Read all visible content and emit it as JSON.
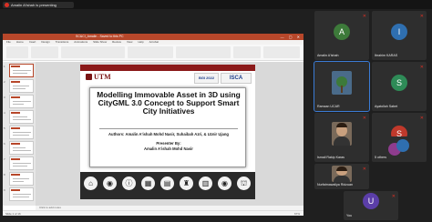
{
  "meeting": {
    "presenting_label": "Amalin A'ishah is presenting"
  },
  "powerpoint": {
    "title": "SC&CI_Amalin - Saved to this PC",
    "window_controls": "— ▢ ✕",
    "tabs": [
      "File",
      "Home",
      "Insert",
      "Design",
      "Transitions",
      "Animations",
      "Slide Show",
      "Review",
      "View",
      "Help",
      "Acrobat"
    ],
    "thumb_numbers": [
      "1",
      "2",
      "3",
      "4",
      "5",
      "6",
      "7",
      "8",
      "9"
    ],
    "notes_placeholder": "Click to add notes",
    "status_text": "Slide 1 of 16",
    "zoom_text": "67%"
  },
  "slide": {
    "logo_text": "UTM",
    "partner1": "BGI 2022",
    "partner2": "ISCA",
    "title": "Modelling Immovable Asset in 3D using CityGML 3.0 Concept to Support Smart City Initiatives",
    "authors": "Authors: Amalin A'ishah Mohd Nasir, Suhaibah Azri, & Uznir Ujang",
    "presenter_label": "Presenter By:",
    "presenter_name": "Amalin A'ishah Mohd Nasir",
    "icons": [
      "home-icon",
      "car-icon",
      "info-icon",
      "building-icon",
      "factory-icon",
      "lighthouse-icon",
      "shop-icon",
      "car-icon",
      "bank-icon"
    ],
    "icon_glyphs": [
      "⌂",
      "◉",
      "ⓘ",
      "▦",
      "▤",
      "♜",
      "▥",
      "◉",
      "⛫"
    ]
  },
  "participants": [
    {
      "name": "Amalin A'ishah",
      "initial": "A",
      "color": "#3d7a3a",
      "type": "avatar",
      "muted": true
    },
    {
      "name": "Ibrahim KARAS",
      "initial": "I",
      "color": "#2f6fb0",
      "type": "avatar",
      "muted": true
    },
    {
      "name": "Ramzan UCAR",
      "initial": "",
      "color": "",
      "type": "tree",
      "muted": false
    },
    {
      "name": "Ayatollah Sabet",
      "initial": "S",
      "color": "#2e8b57",
      "type": "avatar",
      "muted": true
    },
    {
      "name": "Ismail Rakip Karas",
      "initial": "",
      "color": "",
      "type": "photo",
      "muted": true
    },
    {
      "name": "Suhaibah Azri",
      "initial": "S",
      "color": "#c0392b",
      "type": "avatar",
      "muted": true
    },
    {
      "name": "Nurfatmawaliya Ridzuan",
      "initial": "",
      "color": "",
      "type": "photo",
      "muted": true
    },
    {
      "name": "5 others",
      "initial": "",
      "color": "",
      "type": "others",
      "muted": false
    },
    {
      "name": "You",
      "initial": "U",
      "color": "#5b3ea8",
      "type": "avatar",
      "muted": true
    }
  ]
}
